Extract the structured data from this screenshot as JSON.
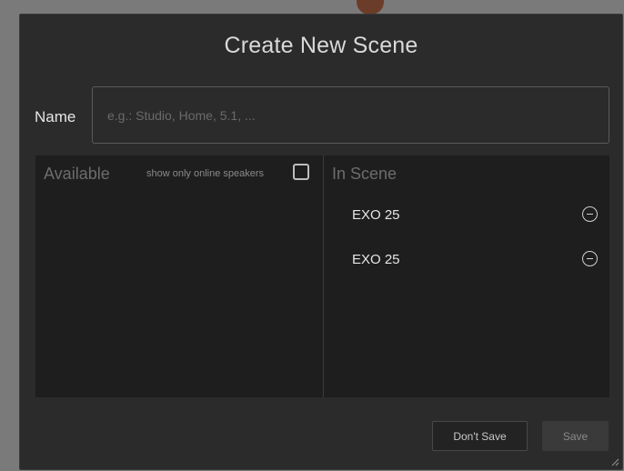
{
  "dialog": {
    "title": "Create New Scene",
    "name_label": "Name",
    "name_value": "",
    "name_placeholder": "e.g.: Studio, Home, 5.1, ..."
  },
  "available": {
    "heading": "Available",
    "online_filter_label": "show only online speakers",
    "online_filter_checked": false,
    "items": []
  },
  "in_scene": {
    "heading": "In Scene",
    "items": [
      {
        "label": "EXO 25",
        "action_icon": "remove-circle-icon"
      },
      {
        "label": "EXO 25",
        "action_icon": "remove-circle-icon"
      }
    ]
  },
  "buttons": {
    "dont_save_label": "Don't Save",
    "save_label": "Save",
    "save_enabled": false
  },
  "colors": {
    "dialog_bg": "#2b2b2b",
    "panel_bg": "#1e1e1e",
    "text_primary": "#e6e6e6",
    "text_muted": "#6c6c6c",
    "accent_backdrop": "#6b3d28"
  }
}
